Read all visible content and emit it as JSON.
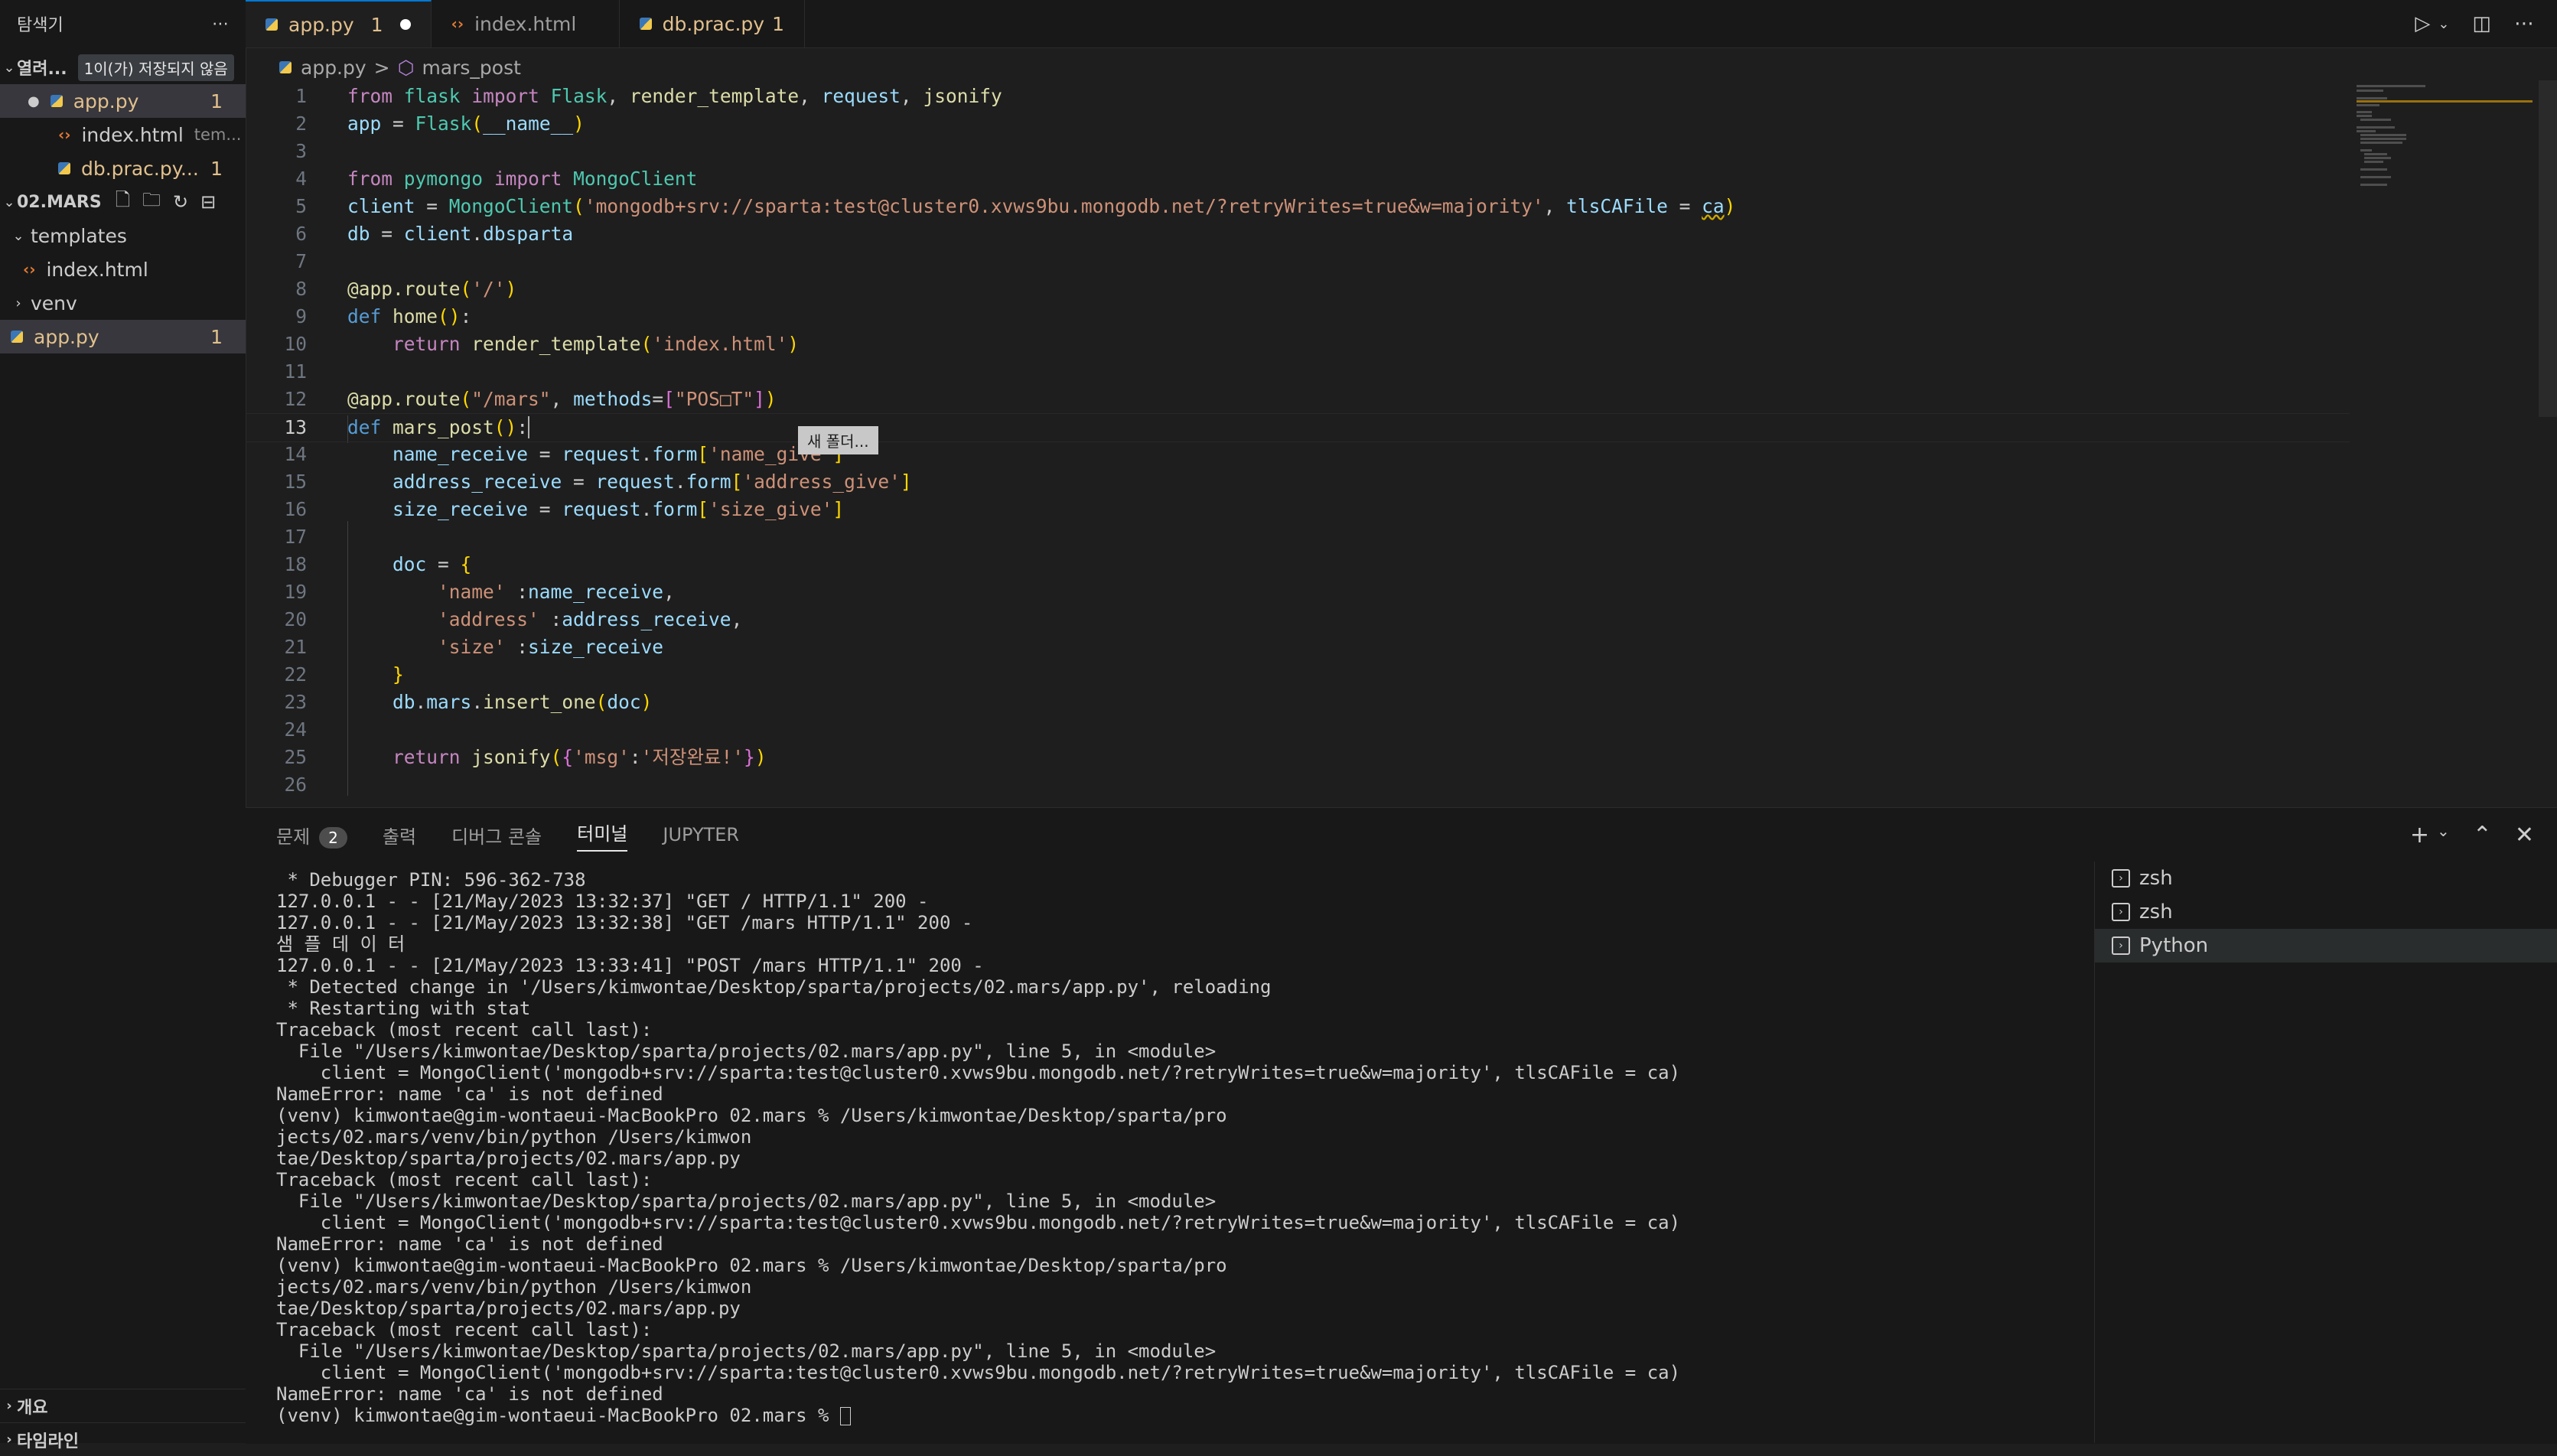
{
  "explorer": {
    "title": "탐색기",
    "more": "⋯",
    "open_editors_label": "열려...",
    "unsaved_badge": "1이(가) 저장되지 않음",
    "open_editors": [
      {
        "name": "app.py",
        "detail": "",
        "count": "1"
      },
      {
        "name": "index.html",
        "detail": "tem...",
        "count": ""
      },
      {
        "name": "db.prac.py...",
        "detail": "",
        "count": "1"
      }
    ],
    "project_label": "02.MARS",
    "tree": [
      {
        "name": "templates"
      },
      {
        "name": "index.html"
      },
      {
        "name": "venv"
      },
      {
        "name": "app.py",
        "count": "1"
      }
    ],
    "outline_label": "개요",
    "timeline_label": "타임라인"
  },
  "tabs": [
    {
      "name": "app.py",
      "count": "1"
    },
    {
      "name": "index.html",
      "count": ""
    },
    {
      "name": "db.prac.py",
      "count": "1"
    }
  ],
  "breadcrumb": {
    "file": "app.py",
    "sep": ">",
    "symbol": "mars_post"
  },
  "hover_tip": "새 폴더...",
  "code_lines": [
    "1",
    "2",
    "3",
    "4",
    "5",
    "6",
    "7",
    "8",
    "9",
    "10",
    "11",
    "12",
    "13",
    "14",
    "15",
    "16",
    "17",
    "18",
    "19",
    "20",
    "21",
    "22",
    "23",
    "24",
    "25",
    "26"
  ],
  "panel": {
    "tabs": [
      "문제",
      "출력",
      "디버그 콘솔",
      "터미널",
      "JUPYTER"
    ],
    "problem_count": "2",
    "terminals": [
      "zsh",
      "zsh",
      "Python"
    ]
  },
  "terminal_lines": [
    " * Debugger PIN: 596-362-738",
    "127.0.0.1 - - [21/May/2023 13:32:37] \"GET / HTTP/1.1\" 200 -",
    "127.0.0.1 - - [21/May/2023 13:32:38] \"GET /mars HTTP/1.1\" 200 -",
    "샘 플 데 이 터",
    "127.0.0.1 - - [21/May/2023 13:33:41] \"POST /mars HTTP/1.1\" 200 -",
    " * Detected change in '/Users/kimwontae/Desktop/sparta/projects/02.mars/app.py', reloading",
    " * Restarting with stat",
    "Traceback (most recent call last):",
    "  File \"/Users/kimwontae/Desktop/sparta/projects/02.mars/app.py\", line 5, in <module>",
    "    client = MongoClient('mongodb+srv://sparta:test@cluster0.xvws9bu.mongodb.net/?retryWrites=true&w=majority', tlsCAFile = ca)",
    "NameError: name 'ca' is not defined",
    "(venv) kimwontae@gim-wontaeui-MacBookPro 02.mars % /Users/kimwontae/Desktop/sparta/pro",
    "jects/02.mars/venv/bin/python /Users/kimwon",
    "tae/Desktop/sparta/projects/02.mars/app.py",
    "Traceback (most recent call last):",
    "  File \"/Users/kimwontae/Desktop/sparta/projects/02.mars/app.py\", line 5, in <module>",
    "    client = MongoClient('mongodb+srv://sparta:test@cluster0.xvws9bu.mongodb.net/?retryWrites=true&w=majority', tlsCAFile = ca)",
    "NameError: name 'ca' is not defined",
    "(venv) kimwontae@gim-wontaeui-MacBookPro 02.mars % /Users/kimwontae/Desktop/sparta/pro",
    "jects/02.mars/venv/bin/python /Users/kimwon",
    "tae/Desktop/sparta/projects/02.mars/app.py",
    "Traceback (most recent call last):",
    "  File \"/Users/kimwontae/Desktop/sparta/projects/02.mars/app.py\", line 5, in <module>",
    "    client = MongoClient('mongodb+srv://sparta:test@cluster0.xvws9bu.mongodb.net/?retryWrites=true&w=majority', tlsCAFile = ca)",
    "NameError: name 'ca' is not defined",
    "(venv) kimwontae@gim-wontaeui-MacBookPro 02.mars % "
  ],
  "code": {
    "l1": [
      "from",
      "flask",
      "import",
      "Flask",
      "render_template",
      "request",
      "jsonify"
    ],
    "l2": [
      "app",
      "Flask",
      "__name__"
    ],
    "l4": [
      "from",
      "pymongo",
      "import",
      "MongoClient"
    ],
    "l5": [
      "client",
      "MongoClient",
      "'mongodb+srv://sparta:test@cluster0.xvws9bu.mongodb.net/?retryWrites=true&w=majority'",
      "tlsCAFile",
      "ca"
    ],
    "l6": [
      "db",
      "client",
      "dbsparta"
    ],
    "l8": [
      "@app.route",
      "'/'"
    ],
    "l9": [
      "def",
      "home"
    ],
    "l10": [
      "return",
      "render_template",
      "'index.html'"
    ],
    "l12": [
      "@app.route",
      "\"/mars\"",
      "methods",
      "\"POS□T\""
    ],
    "l13": [
      "def",
      "mars_post"
    ],
    "l14": [
      "name_receive",
      "request",
      "form",
      "'name_give'"
    ],
    "l15": [
      "address_receive",
      "request",
      "form",
      "'address_give'"
    ],
    "l16": [
      "size_receive",
      "request",
      "form",
      "'size_give'"
    ],
    "l18": [
      "doc"
    ],
    "l19": [
      "'name'",
      "name_receive"
    ],
    "l20": [
      "'address'",
      "address_receive"
    ],
    "l21": [
      "'size'",
      "size_receive"
    ],
    "l23": [
      "db",
      "mars",
      "insert_one",
      "doc"
    ],
    "l25": [
      "return",
      "jsonify",
      "'msg'",
      "'저장완료!'"
    ]
  }
}
